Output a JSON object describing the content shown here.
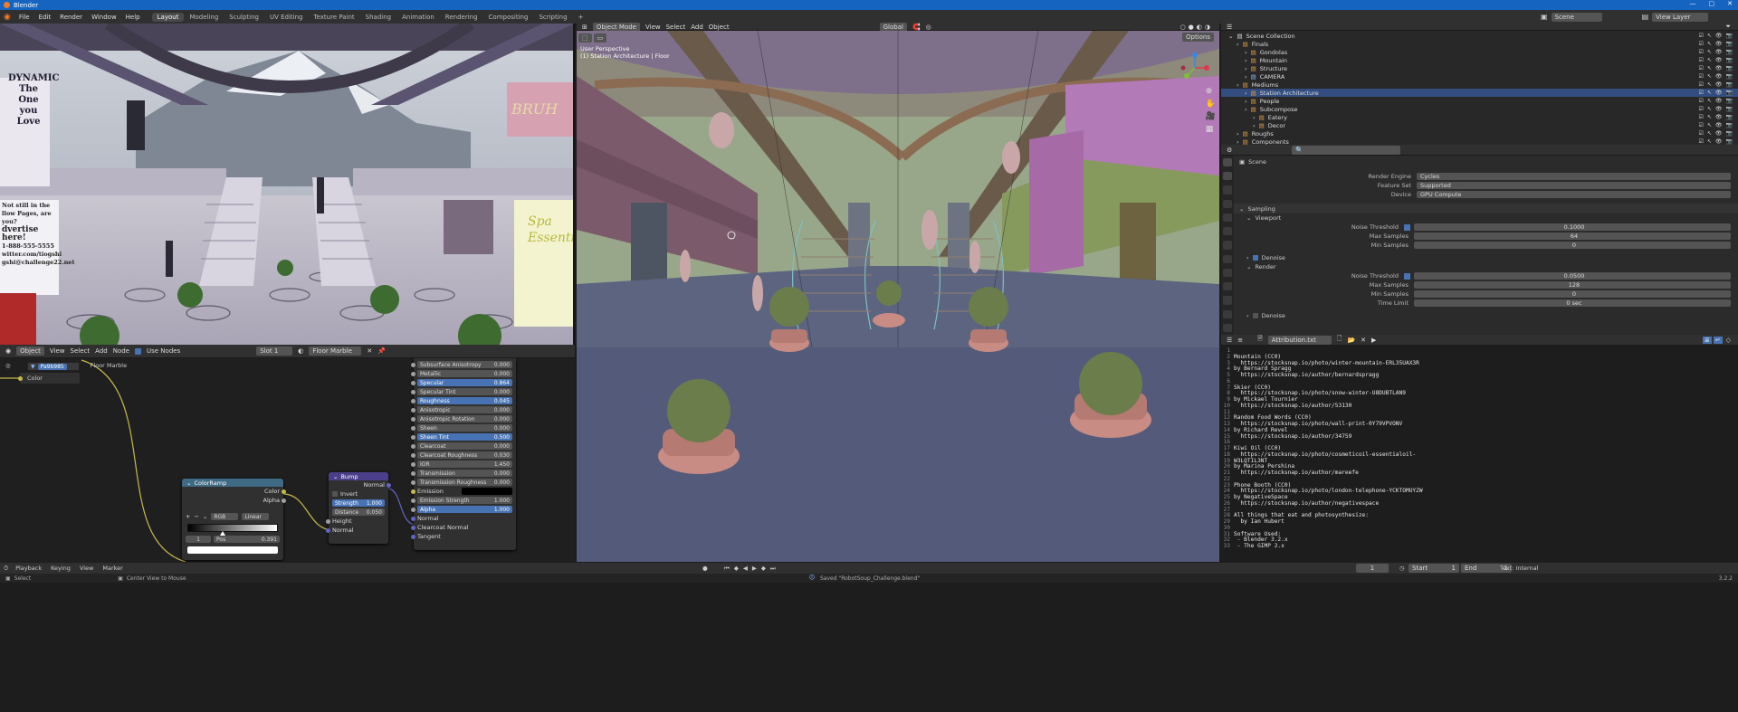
{
  "app": {
    "title": "Blender"
  },
  "menu": [
    "File",
    "Edit",
    "Render",
    "Window",
    "Help"
  ],
  "workspaces": [
    "Layout",
    "Modeling",
    "Sculpting",
    "UV Editing",
    "Texture Paint",
    "Shading",
    "Animation",
    "Rendering",
    "Compositing",
    "Scripting"
  ],
  "active_workspace": "Layout",
  "viewport": {
    "mode": "Object Mode",
    "menus": [
      "View",
      "Select",
      "Add",
      "Object"
    ],
    "perspective": "User Perspective",
    "collection_info": "(1) Station Architecture | Floor",
    "transform": "Global",
    "options": "Options"
  },
  "render_poster": {
    "left_top": "DYNAMIC",
    "left_words": [
      "The",
      "One",
      "you",
      "Love"
    ],
    "ad_lines": [
      "Not still in the",
      "llow Pages, are you?",
      "dvertise here!",
      "1-888-555-5555",
      "witter.com/tiogshi",
      "gshi@challenge22.net"
    ],
    "bruh": "BRUH",
    "spa": "Spa Essentials"
  },
  "node_editor": {
    "header": {
      "type": "Object",
      "menus": [
        "View",
        "Select",
        "Add",
        "Node"
      ],
      "use_nodes": "Use Nodes",
      "slot": "Slot 1",
      "material": "Floor Marble"
    },
    "crumb": "Floor Marble",
    "popup": "Pa9b985",
    "small_node_label": "Color",
    "bsdf_rows": [
      {
        "name": "Subsurface Anisotropy",
        "value": "0.000",
        "hl": false
      },
      {
        "name": "Metallic",
        "value": "0.000",
        "hl": false
      },
      {
        "name": "Specular",
        "value": "0.864",
        "hl": true
      },
      {
        "name": "Specular Tint",
        "value": "0.000",
        "hl": false
      },
      {
        "name": "Roughness",
        "value": "0.045",
        "hl": true
      },
      {
        "name": "Anisotropic",
        "value": "0.000",
        "hl": false
      },
      {
        "name": "Anisotropic Rotation",
        "value": "0.000",
        "hl": false
      },
      {
        "name": "Sheen",
        "value": "0.000",
        "hl": false
      },
      {
        "name": "Sheen Tint",
        "value": "0.500",
        "hl": true
      },
      {
        "name": "Clearcoat",
        "value": "0.000",
        "hl": false
      },
      {
        "name": "Clearcoat Roughness",
        "value": "0.030",
        "hl": false
      },
      {
        "name": "IOR",
        "value": "1.450",
        "hl": false
      },
      {
        "name": "Transmission",
        "value": "0.000",
        "hl": false
      },
      {
        "name": "Transmission Roughness",
        "value": "0.000",
        "hl": false
      }
    ],
    "emission": "Emission",
    "emission_strength": {
      "name": "Emission Strength",
      "value": "1.000"
    },
    "alpha": {
      "name": "Alpha",
      "value": "1.000"
    },
    "bsdf_inputs": [
      "Normal",
      "Clearcoat Normal",
      "Tangent"
    ],
    "colorramp": {
      "title": "ColorRamp",
      "out_color": "Color",
      "out_alpha": "Alpha",
      "mode": "RGB",
      "interp": "Linear",
      "index": "1",
      "pos_label": "Pos",
      "pos": "0.391",
      "stop_fraction": 0.391
    },
    "bump": {
      "title": "Bump",
      "out": "Normal",
      "invert": "Invert",
      "strength_label": "Strength",
      "strength": "1.000",
      "distance_label": "Distance",
      "distance": "0.050",
      "height": "Height",
      "normal": "Normal"
    }
  },
  "outliner": {
    "view_layer": "View Layer",
    "scene": "Scene",
    "items": [
      {
        "name": "Scene Collection",
        "indent": 0,
        "sel": false
      },
      {
        "name": "Finals",
        "indent": 1,
        "sel": false
      },
      {
        "name": "Gondolas",
        "indent": 2,
        "sel": false
      },
      {
        "name": "Mountain",
        "indent": 2,
        "sel": false
      },
      {
        "name": "Structure",
        "indent": 2,
        "sel": false
      },
      {
        "name": "CAMERA",
        "indent": 2,
        "sel": false
      },
      {
        "name": "Mediums",
        "indent": 1,
        "sel": false
      },
      {
        "name": "Station Architecture",
        "indent": 2,
        "sel": true
      },
      {
        "name": "People",
        "indent": 2,
        "sel": false
      },
      {
        "name": "Subcompose",
        "indent": 2,
        "sel": false
      },
      {
        "name": "Eatery",
        "indent": 3,
        "sel": false
      },
      {
        "name": "Decor",
        "indent": 3,
        "sel": false
      },
      {
        "name": "Roughs",
        "indent": 1,
        "sel": false
      },
      {
        "name": "Components",
        "indent": 1,
        "sel": false
      }
    ]
  },
  "properties": {
    "scene": "Scene",
    "render_engine": {
      "label": "Render Engine",
      "value": "Cycles"
    },
    "feature_set": {
      "label": "Feature Set",
      "value": "Supported"
    },
    "device": {
      "label": "Device",
      "value": "GPU Compute"
    },
    "sampling": "Sampling",
    "viewport": "Viewport",
    "vp_noise": {
      "label": "Noise Threshold",
      "value": "0.1000"
    },
    "vp_max": {
      "label": "Max Samples",
      "value": "64"
    },
    "vp_min": {
      "label": "Min Samples",
      "value": "0"
    },
    "denoise": "Denoise",
    "render": "Render",
    "r_noise": {
      "label": "Noise Threshold",
      "value": "0.0500"
    },
    "r_max": {
      "label": "Max Samples",
      "value": "128"
    },
    "r_min": {
      "label": "Min Samples",
      "value": "0"
    },
    "time_limit": {
      "label": "Time Limit",
      "value": "0 sec"
    },
    "denoise2": "Denoise"
  },
  "text_editor": {
    "filename": "Attribution.txt",
    "status": "Text: Internal",
    "lines": [
      "",
      "Mountain (CC0)",
      "  https://stocksnap.io/photo/winter-mountain-ERL35UAX3R",
      "by Bernard Spragg",
      "  https://stocksnap.io/author/bernardspragg",
      "",
      "Skier (CC0)",
      "  https://stocksnap.io/photo/snow-winter-U8DUBTLAN9",
      "by Mickael Tournier",
      "  https://stocksnap.io/author/53130",
      "",
      "Random Food Words (CC0)",
      "  https://stocksnap.io/photo/wall-print-0Y79VPVONV",
      "by Richard Revel",
      "  https://stocksnap.io/author/34759",
      "",
      "Kiwi Oil (CC0)",
      "  https://stocksnap.io/photo/cosmeticoil-essentialoil-",
      "W3LQTIL3NT",
      "by Marina Pershina",
      "  https://stocksnap.io/author/mareefe",
      "",
      "Phone Booth (CC0)",
      "  https://stocksnap.io/photo/london-telephone-YCKTOMUYZW",
      "by NegativeSpace",
      "  https://stocksnap.io/author/negativespace",
      "",
      "All things that eat and photosynthesize:",
      "  by Ian Hubert",
      "",
      "Software Used:",
      " - Blender 3.2.x",
      " - The GIMP 2.x"
    ]
  },
  "timeline": {
    "menus": [
      "Playback",
      "Keying",
      "View",
      "Marker"
    ],
    "current": "1",
    "start_label": "Start",
    "start": "1",
    "end_label": "End",
    "end": "1"
  },
  "status": {
    "select": "Select",
    "center": "Center View to Mouse",
    "saved": "Saved \"RobotSoup_Challenge.blend\"",
    "version": "3.2.2"
  }
}
